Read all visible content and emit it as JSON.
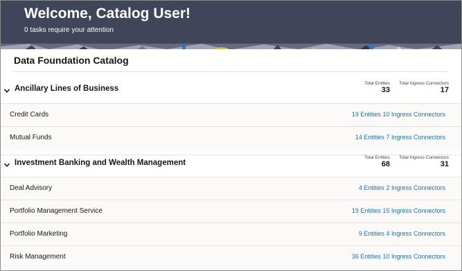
{
  "header": {
    "welcome": "Welcome, Catalog User!",
    "tasks": "0 tasks require your attention"
  },
  "catalog": {
    "title": "Data Foundation Catalog"
  },
  "labels": {
    "total_entities": "Total Entities",
    "total_ingress": "Total Ingress Connectors"
  },
  "groups": [
    {
      "title": "Ancillary Lines of Business",
      "total_entities": "33",
      "total_ingress": "17",
      "items": [
        {
          "label": "Credit Cards",
          "entities": "19 Entities",
          "connectors": "10 Ingress Connectors"
        },
        {
          "label": "Mutual Funds",
          "entities": "14 Entities",
          "connectors": "7 Ingress Connectors"
        }
      ]
    },
    {
      "title": "Investment Banking and Wealth Management",
      "total_entities": "68",
      "total_ingress": "31",
      "items": [
        {
          "label": "Deal Advisory",
          "entities": "4 Entities",
          "connectors": "2 Ingress Connectors"
        },
        {
          "label": "Portfolio Management Service",
          "entities": "19 Entities",
          "connectors": "15 Ingress Connectors"
        },
        {
          "label": "Portfolio Marketing",
          "entities": "9 Entities",
          "connectors": "4 Ingress Connectors"
        },
        {
          "label": "Risk Management",
          "entities": "36 Entities",
          "connectors": "10 Ingress Connectors"
        }
      ]
    }
  ],
  "colors": {
    "banner": "#3f4659",
    "link": "#1d6fa5",
    "accent_yellow": "#f2c94c"
  },
  "icons": {
    "collapse": "chevron-down-icon"
  }
}
